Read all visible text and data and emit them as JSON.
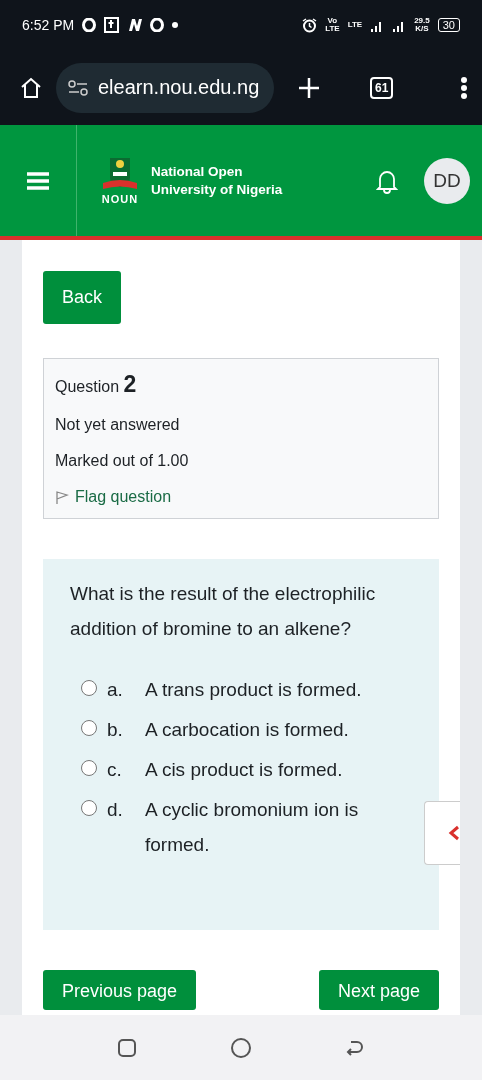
{
  "status_bar": {
    "time": "6:52 PM",
    "volte": [
      "Vo",
      "LTE"
    ],
    "lte": "LTE",
    "speed": [
      "29.5",
      "K/S"
    ],
    "battery": "30"
  },
  "browser": {
    "url": "elearn.nou.edu.ng",
    "tab_count": "61"
  },
  "site_header": {
    "logo_text": "NOUN",
    "title_lines": [
      "National Open",
      "University of Nigeria"
    ],
    "avatar": "DD"
  },
  "back_button": "Back",
  "question_info": {
    "label": "Question",
    "number": "2",
    "status": "Not yet answered",
    "marks": "Marked out of 1.00",
    "flag": "Flag question"
  },
  "question": {
    "text": "What is the result of the electrophilic addition of bromine to an alkene?",
    "options": [
      {
        "letter": "a.",
        "text": "A trans product is formed.",
        "selected": false
      },
      {
        "letter": "b.",
        "text": "A carbocation is formed.",
        "selected": false
      },
      {
        "letter": "c.",
        "text": "A cis product is formed.",
        "selected": false
      },
      {
        "letter": "d.",
        "text": "A cyclic bromonium ion is formed.",
        "selected": false
      }
    ]
  },
  "navigation": {
    "previous": "Previous page",
    "next": "Next page"
  }
}
